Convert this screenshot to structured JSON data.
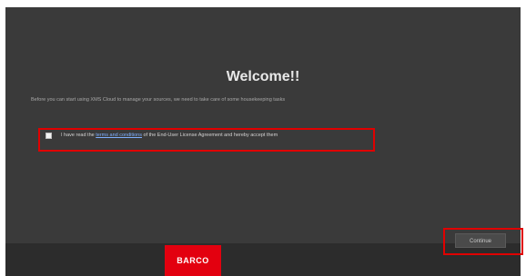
{
  "welcome": {
    "title": "Welcome!!",
    "subtitle": "Before you can start using XMS Cloud to manage your sources, we need to take care of some housekeeping tasks"
  },
  "eula": {
    "text_before": "I have read the",
    "link_text": "terms and conditions",
    "text_after": "of the End-User License Agreement and hereby accept them",
    "checked": false
  },
  "actions": {
    "continue_label": "Continue"
  },
  "brand": {
    "logo_text": "BARCO",
    "logo_color": "#e3000f"
  },
  "colors": {
    "background": "#3a3a3a",
    "highlight": "#e00000",
    "link": "#7fb0ff"
  }
}
